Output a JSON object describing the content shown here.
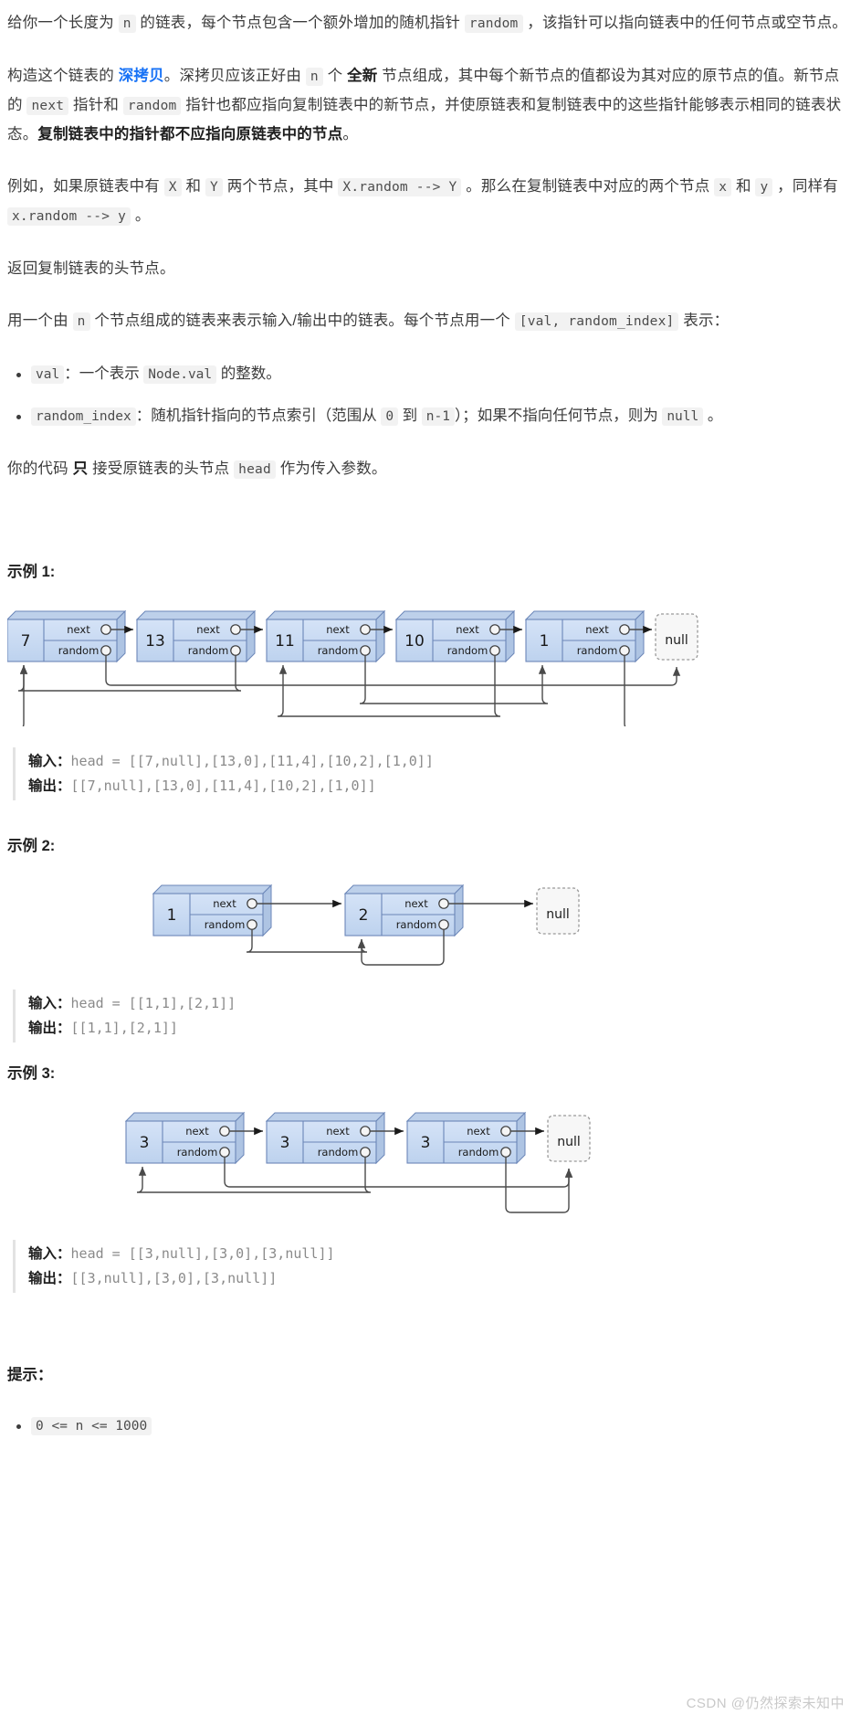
{
  "problem": {
    "paragraphs": [
      {
        "id": "p1",
        "parts": [
          {
            "t": "text",
            "v": "给你一个长度为 "
          },
          {
            "t": "code",
            "v": "n"
          },
          {
            "t": "text",
            "v": " 的链表，每个节点包含一个额外增加的随机指针 "
          },
          {
            "t": "code",
            "v": "random"
          },
          {
            "t": "text",
            "v": " ，该指针可以指向链表中的任何节点或空节点。"
          }
        ]
      },
      {
        "id": "p2",
        "parts": [
          {
            "t": "text",
            "v": "构造这个链表的 "
          },
          {
            "t": "link",
            "v": "深拷贝"
          },
          {
            "t": "text",
            "v": "。深拷贝应该正好由 "
          },
          {
            "t": "code",
            "v": "n"
          },
          {
            "t": "text",
            "v": " 个 "
          },
          {
            "t": "bold",
            "v": "全新"
          },
          {
            "t": "text",
            "v": " 节点组成，其中每个新节点的值都设为其对应的原节点的值。新节点的 "
          },
          {
            "t": "code",
            "v": "next"
          },
          {
            "t": "text",
            "v": " 指针和 "
          },
          {
            "t": "code",
            "v": "random"
          },
          {
            "t": "text",
            "v": " 指针也都应指向复制链表中的新节点，并使原链表和复制链表中的这些指针能够表示相同的链表状态。"
          },
          {
            "t": "bold",
            "v": "复制链表中的指针都不应指向原链表中的节点"
          },
          {
            "t": "text",
            "v": "。"
          }
        ]
      },
      {
        "id": "p3",
        "parts": [
          {
            "t": "text",
            "v": "例如，如果原链表中有 "
          },
          {
            "t": "code",
            "v": "X"
          },
          {
            "t": "text",
            "v": " 和 "
          },
          {
            "t": "code",
            "v": "Y"
          },
          {
            "t": "text",
            "v": " 两个节点，其中 "
          },
          {
            "t": "code",
            "v": "X.random --> Y"
          },
          {
            "t": "text",
            "v": " 。那么在复制链表中对应的两个节点 "
          },
          {
            "t": "code",
            "v": "x"
          },
          {
            "t": "text",
            "v": " 和 "
          },
          {
            "t": "code",
            "v": "y"
          },
          {
            "t": "text",
            "v": " ，同样有 "
          },
          {
            "t": "code",
            "v": "x.random --> y"
          },
          {
            "t": "text",
            "v": " 。"
          }
        ]
      },
      {
        "id": "p4",
        "parts": [
          {
            "t": "text",
            "v": "返回复制链表的头节点。"
          }
        ]
      },
      {
        "id": "p5",
        "parts": [
          {
            "t": "text",
            "v": "用一个由 "
          },
          {
            "t": "code",
            "v": "n"
          },
          {
            "t": "text",
            "v": " 个节点组成的链表来表示输入/输出中的链表。每个节点用一个 "
          },
          {
            "t": "code",
            "v": "[val, random_index]"
          },
          {
            "t": "text",
            "v": " 表示："
          }
        ]
      }
    ],
    "bullets": [
      {
        "id": "b1",
        "parts": [
          {
            "t": "code",
            "v": "val"
          },
          {
            "t": "text",
            "v": "：一个表示 "
          },
          {
            "t": "code",
            "v": "Node.val"
          },
          {
            "t": "text",
            "v": " 的整数。"
          }
        ]
      },
      {
        "id": "b2",
        "parts": [
          {
            "t": "code",
            "v": "random_index"
          },
          {
            "t": "text",
            "v": "：随机指针指向的节点索引（范围从 "
          },
          {
            "t": "code",
            "v": "0"
          },
          {
            "t": "text",
            "v": " 到 "
          },
          {
            "t": "code",
            "v": "n-1"
          },
          {
            "t": "text",
            "v": "）；如果不指向任何节点，则为 "
          },
          {
            "t": "code",
            "v": "null"
          },
          {
            "t": "text",
            "v": " 。"
          }
        ]
      }
    ],
    "closing": {
      "id": "p6",
      "parts": [
        {
          "t": "text",
          "v": "你的代码 "
        },
        {
          "t": "bold",
          "v": "只"
        },
        {
          "t": "text",
          "v": " 接受原链表的头节点 "
        },
        {
          "t": "code",
          "v": "head"
        },
        {
          "t": "text",
          "v": " 作为传入参数。"
        }
      ]
    }
  },
  "node_labels": {
    "next": "next",
    "random": "random",
    "null": "null"
  },
  "examples": [
    {
      "title": "示例 1:",
      "input_label": "输入：",
      "output_label": "输出：",
      "input_value": "head = [[7,null],[13,0],[11,4],[10,2],[1,0]]",
      "output_value": "[[7,null],[13,0],[11,4],[10,2],[1,0]]",
      "nodes": [
        {
          "val": "7",
          "random_index": null
        },
        {
          "val": "13",
          "random_index": 0
        },
        {
          "val": "11",
          "random_index": 4
        },
        {
          "val": "10",
          "random_index": 2
        },
        {
          "val": "1",
          "random_index": 0
        }
      ]
    },
    {
      "title": "示例 2:",
      "input_label": "输入：",
      "output_label": "输出：",
      "input_value": "head = [[1,1],[2,1]]",
      "output_value": "[[1,1],[2,1]]",
      "nodes": [
        {
          "val": "1",
          "random_index": 1
        },
        {
          "val": "2",
          "random_index": 1
        }
      ]
    },
    {
      "title": "示例 3:",
      "input_label": "输入：",
      "output_label": "输出：",
      "input_value": "head = [[3,null],[3,0],[3,null]]",
      "output_value": "[[3,null],[3,0],[3,null]]",
      "nodes": [
        {
          "val": "3",
          "random_index": null
        },
        {
          "val": "3",
          "random_index": 0
        },
        {
          "val": "3",
          "random_index": null
        }
      ]
    }
  ],
  "hints": {
    "title": "提示：",
    "items": [
      "0 <= n <= 1000"
    ]
  },
  "watermark": "CSDN @仍然探索未知中",
  "colors": {
    "node_fill": "#c7d9f2",
    "node_stroke": "#6b86b8",
    "link": "#1772f6",
    "code_bg": "#f2f2f2",
    "text": "#3c3c3c"
  }
}
